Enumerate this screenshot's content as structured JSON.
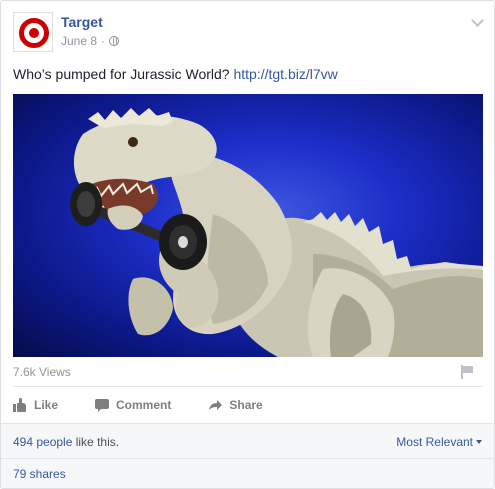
{
  "post": {
    "page_name": "Target",
    "date": "June 8",
    "separator": "·",
    "audience_icon": "globe-icon",
    "text_prefix": "Who’s pumped for Jurassic World? ",
    "link_text": "http://tgt.biz/l7vw"
  },
  "video": {
    "views": "7.6k Views",
    "subject": "dinosaur toy lifting a dumbbell on blue background"
  },
  "actions": {
    "like": "Like",
    "comment": "Comment",
    "share": "Share"
  },
  "footer": {
    "likes_count_link": "494 people",
    "likes_suffix": " like this.",
    "sort_label": "Most Relevant",
    "shares": "79 shares"
  },
  "colors": {
    "brand_red": "#cc0000",
    "link_blue": "#365899",
    "muted": "#90949c",
    "video_bg": "#1c2ec8"
  }
}
